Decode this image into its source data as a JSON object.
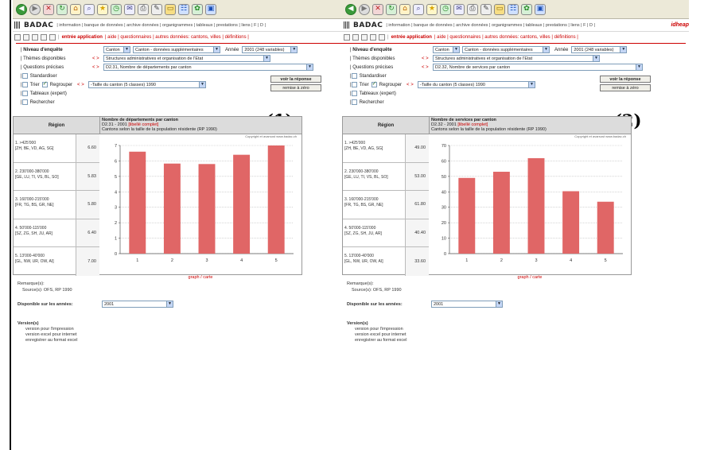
{
  "toolbar": {
    "icons": [
      "back-icon",
      "forward-icon",
      "stop-icon",
      "refresh-icon",
      "home-icon",
      "search-icon",
      "favorites-icon",
      "history-icon",
      "mail-icon",
      "print-icon",
      "edit-icon",
      "folder-icon",
      "messenger-icon",
      "tool-icon"
    ]
  },
  "topnav": {
    "logo": "BADAC",
    "links": "| information | banque de données | archive données | organigrammes | tableaux | prestations | liens | F | D |",
    "brand": "idheap"
  },
  "subnav": {
    "entree": "entrée application",
    "links": "| aide | questionnaires | autres données: cantons, villes | définitions |"
  },
  "form": {
    "niveau_label": "Niveau d'enquête",
    "niveau_value": "Canton",
    "niveau_sub": "Canton - données supplémentaires",
    "annee_label": "Année",
    "annee_value": "2001 (248 variables)",
    "themes_label": "Thèmes disponibles",
    "themes_value": "Structures administratives et organisation de l'Etat",
    "questions_label": "Questions précises",
    "standardiser": "Standardiser",
    "trier": "Trier",
    "regrouper": "Regrouper",
    "regroup_value": "-Taille du canton (5 classes) 1990",
    "tableaux": "Tableaux (expert)",
    "rechercher": "Rechercher",
    "voir": "voir la réponse",
    "remise": "remise à zéro",
    "arrows": "< >"
  },
  "table": {
    "region_header": "Région",
    "subtitle": "Cantons selon la taille de la population résidente (RP 1990)",
    "copyright": "Copyright et avarsost www.badac.ch",
    "graph_link": "graph / carte",
    "regions": [
      {
        "name": "1. >425'000",
        "cantons": "[ZH, BE, VD, AG, SG]"
      },
      {
        "name": "2. 230'000-380'000",
        "cantons": "[GE, LU, TI, VS, BL, SO]"
      },
      {
        "name": "3. 160'000-215'000",
        "cantons": "[FR, TG, BS, GR, NE]"
      },
      {
        "name": "4. 50'000-115'000",
        "cantons": "[SZ, ZG, SH, JU, AR]"
      },
      {
        "name": "5. 13'000-40'000",
        "cantons": "[GL, NW, UR, OW, AI]"
      }
    ]
  },
  "below": {
    "remarques": "Remarque(s):",
    "sources": "Source(s): OFS, RP 1990",
    "dispo_label": "Disponible sur les années:",
    "dispo_value": "2001",
    "version_title": "Version(s)",
    "version_links": [
      "version pour l'impression",
      "version excel pour internet",
      "enregistrer au format excel"
    ]
  },
  "panels": [
    {
      "tag": "(1)",
      "question": "D2.31, Nombre de départements par canton",
      "title": "Nombre de départements par canton",
      "code": "D2.31 - 2001",
      "libelle": "[libellé complet]"
    },
    {
      "tag": "(2)",
      "question": "D2.32, Nombre de services par canton",
      "title": "Nombre de services par canton",
      "code": "D2.32 - 2001",
      "libelle": "[libellé complet]"
    }
  ],
  "chart_data": [
    {
      "type": "bar",
      "title": "Nombre de départements par canton",
      "categories": [
        "1",
        "2",
        "3",
        "4",
        "5"
      ],
      "values": [
        6.6,
        5.83,
        5.8,
        6.4,
        7.0
      ],
      "ylim": [
        0,
        7
      ],
      "yticks": [
        0,
        1,
        2,
        3,
        4,
        5,
        6,
        7
      ],
      "grid": true,
      "bar_color": "#e06666"
    },
    {
      "type": "bar",
      "title": "Nombre de services par canton",
      "categories": [
        "1",
        "2",
        "3",
        "4",
        "5"
      ],
      "values": [
        49.0,
        53.0,
        61.8,
        40.4,
        33.6
      ],
      "ylim": [
        0,
        70
      ],
      "yticks": [
        0,
        10,
        20,
        30,
        40,
        50,
        60,
        70
      ],
      "grid": true,
      "bar_color": "#e06666"
    }
  ]
}
